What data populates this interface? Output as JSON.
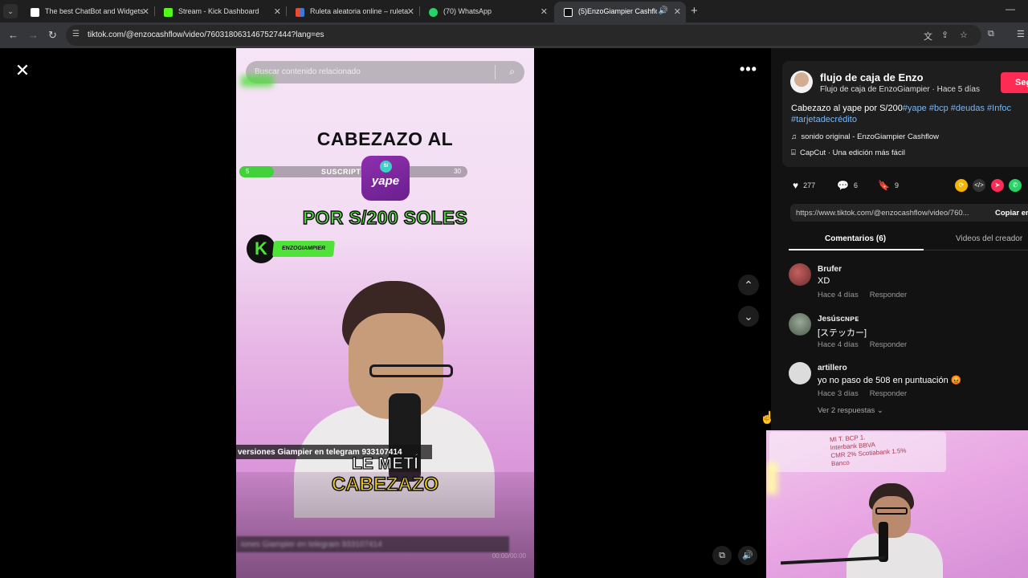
{
  "browser": {
    "tabs": [
      {
        "title": "The best ChatBot and Widgets",
        "favicon_color": "#ffffff"
      },
      {
        "title": "Stream - Kick Dashboard",
        "favicon_color": "#53fc18"
      },
      {
        "title": "Ruleta aleatoria online – ruleta",
        "favicon_color": "#e94b35"
      },
      {
        "title": "(70) WhatsApp",
        "favicon_color": "#25d366"
      },
      {
        "title": "(5)EnzoGiampier Cashflow |",
        "favicon_color": "#ffffff"
      }
    ],
    "url": "tiktok.com/@enzocashflow/video/7603180631467527444?lang=es"
  },
  "player": {
    "search_placeholder": "Buscar contenido relacionado",
    "headline_top": "CABEZAZO AL",
    "progress": {
      "min": "5",
      "label": "SUSCRIPT",
      "max": "30",
      "fraction": 0.15
    },
    "yape_coin": "S/",
    "yape_word": "yape",
    "headline_bottom": "POR S/200 SOLES",
    "kick_letter": "K",
    "kick_handle": "ENZOGIAMPIER",
    "telegram_banner": "versiones Giampier en telegram 933107414",
    "caption_line1": "LE METÍ",
    "caption_line2": "CABEZAZO",
    "ghost_banner": "iones Giampier en telegram 933107414",
    "timecode": "00:00/00:00"
  },
  "sidebar": {
    "author_name": "flujo de caja de Enzo",
    "author_sub": "Flujo de caja de EnzoGiampier · Hace 5 días",
    "follow_label": "Seg",
    "description": "Cabezazo al yape por S/200",
    "hashtags_line1": "#yape #bcp #deudas #Infoc",
    "hashtags_line2": "#tarjetadecrédito",
    "sound": "sonido original - EnzoGiampier Cashflow",
    "capcut": "CapCut · Una edición más fácil",
    "likes": "277",
    "comments_count": "6",
    "saves": "9",
    "link_url": "https://www.tiktok.com/@enzocashflow/video/760...",
    "copy_label": "Copiar en",
    "tab_comments": "Comentarios (6)",
    "tab_creator": "Videos del creador",
    "comments": [
      {
        "name": "Brufer",
        "text": "XD",
        "time": "Hace 4 días",
        "reply": "Responder",
        "avatar_color": "#8a4a4a"
      },
      {
        "name": "Jesúsᴄɴᴘᴇ",
        "text": "[ステッカー]",
        "time": "Hace 4 días",
        "reply": "Responder",
        "avatar_color": "#5a6b5a"
      },
      {
        "name": "artillero",
        "text": "yo no paso de 508 en puntuación 😡",
        "time": "Hace 3 días",
        "reply": "Responder",
        "avatar_color": "#d9d9d9"
      }
    ],
    "view_replies": "Ver 2 respuestas ⌄"
  },
  "webcam": {
    "board_text_1": "MI T.   BCP 1.",
    "board_text_2": "Interbank   BBVA",
    "board_text_3": "CMR  2%   Scotiabank 1.5%",
    "board_text_4": "Banco"
  }
}
